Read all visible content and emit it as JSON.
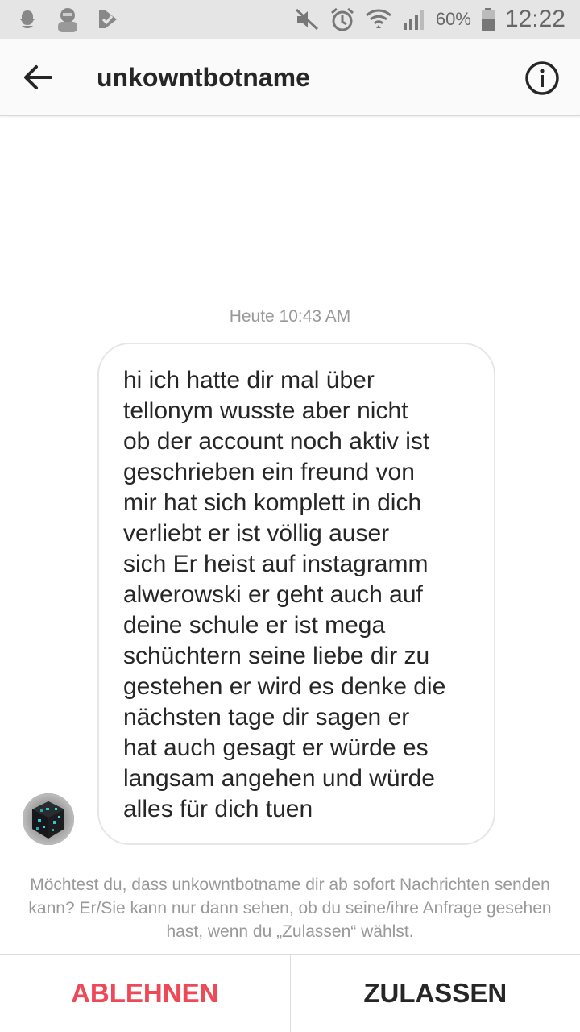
{
  "status_bar": {
    "icons_left": [
      "snapchat-icon",
      "bitmoji-icon",
      "check-app-icon"
    ],
    "icons_right": [
      "mute-icon",
      "alarm-icon",
      "wifi-icon",
      "signal-icon",
      "battery-icon"
    ],
    "battery_percent": "60%",
    "time": "12:22"
  },
  "header": {
    "title": "unkowntbotname",
    "back_icon": "arrow-left-icon",
    "info_icon": "info-icon"
  },
  "conversation": {
    "timestamp": "Heute 10:43 AM",
    "message": "hi ich hatte dir mal über\ntellonym wusste aber nicht\nob der account noch aktiv ist\ngeschrieben ein freund von\nmir hat sich komplett in dich\nverliebt er ist völlig auser\nsich Er heist auf instagramm\nalwerowski er geht auch auf\ndeine schule er ist mega\nschüchtern seine liebe dir zu\ngestehen er wird es denke die\nnächsten tage dir sagen er\nhat auch gesagt er würde es\nlangsam angehen und würde\nalles für dich tuen"
  },
  "request": {
    "notice": "Möchtest du, dass unkowntbotname dir ab sofort Nachrichten senden kann? Er/Sie kann nur dann sehen, ob du seine/ihre Anfrage gesehen hast, wenn du „Zulassen“ wählst.",
    "decline_label": "ABLEHNEN",
    "accept_label": "ZULASSEN"
  },
  "colors": {
    "decline": "#ed4956",
    "text": "#262626",
    "muted": "#999999"
  }
}
